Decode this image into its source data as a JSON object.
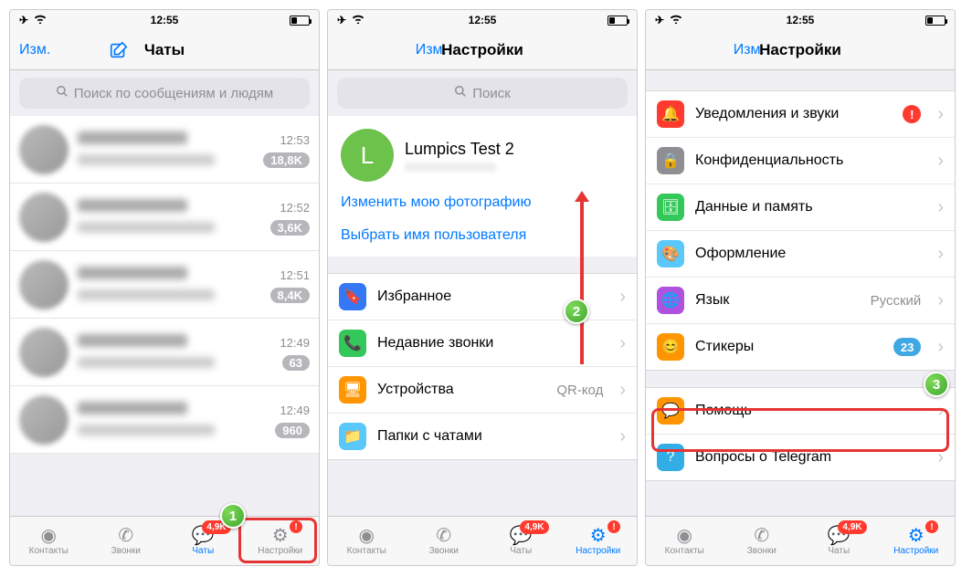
{
  "status": {
    "time": "12:55"
  },
  "screens": {
    "chats": {
      "nav": {
        "edit": "Изм.",
        "title": "Чаты"
      },
      "search": "Поиск по сообщениям и людям",
      "rows": [
        {
          "time": "12:53",
          "badge": "18,8K"
        },
        {
          "time": "12:52",
          "badge": "3,6K"
        },
        {
          "time": "12:51",
          "badge": "8,4K"
        },
        {
          "time": "12:49",
          "badge": "63"
        },
        {
          "time": "12:49",
          "badge": "960"
        }
      ]
    },
    "settings1": {
      "nav": {
        "title": "Настройки",
        "edit": "Изм."
      },
      "search": "Поиск",
      "profile": {
        "initial": "L",
        "name": "Lumpics Test 2"
      },
      "links": {
        "change_photo": "Изменить мою фотографию",
        "choose_username": "Выбрать имя пользователя"
      },
      "items": {
        "saved": "Избранное",
        "recent_calls": "Недавние звонки",
        "devices": "Устройства",
        "devices_value": "QR-код",
        "folders": "Папки с чатами"
      }
    },
    "settings2": {
      "nav": {
        "title": "Настройки",
        "edit": "Изм."
      },
      "items": {
        "notifications": "Уведомления и звуки",
        "notifications_badge": "!",
        "privacy": "Конфиденциальность",
        "data": "Данные и память",
        "appearance": "Оформление",
        "language": "Язык",
        "language_value": "Русский",
        "stickers": "Стикеры",
        "stickers_badge": "23",
        "support": "Помощь",
        "faq": "Вопросы о Telegram"
      }
    }
  },
  "tabs": {
    "contacts": "Контакты",
    "calls": "Звонки",
    "chats": "Чаты",
    "chats_badge": "4,9K",
    "settings": "Настройки",
    "settings_badge": "!"
  },
  "callouts": {
    "one": "1",
    "two": "2",
    "three": "3"
  }
}
